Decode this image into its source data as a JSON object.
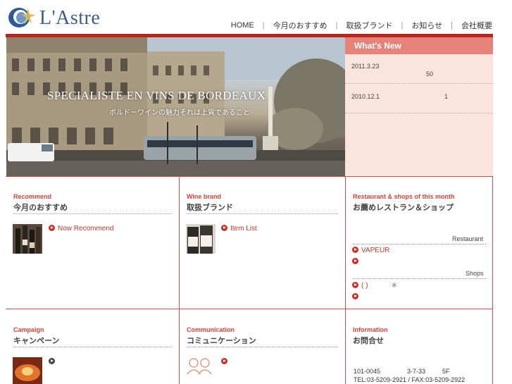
{
  "header": {
    "logo_text": "L'Astre",
    "nav": [
      {
        "label": "HOME"
      },
      {
        "label": "今月のおすすめ"
      },
      {
        "label": "取扱ブランド"
      },
      {
        "label": "お知らせ"
      },
      {
        "label": "会社概要"
      }
    ]
  },
  "hero": {
    "title": "SPECIALISTE EN VINS DE BORDEAUX",
    "subtitle": "ボルドーワインの魅力それは上質であること"
  },
  "news": {
    "heading": "What's New",
    "items": [
      {
        "date": "2011.3.23",
        "value": "50"
      },
      {
        "date": "2010.12.1",
        "value": "1"
      }
    ]
  },
  "sections": {
    "recommend": {
      "tag": "Recommend",
      "title": "今月のおすすめ",
      "link": "Now Recommend"
    },
    "wine_brand": {
      "tag": "Wine brand",
      "title": "取扱ブランド",
      "link": "Item List"
    },
    "restaurant": {
      "tag": "Restaurant & shops of this month",
      "title": "お薦めレストラン＆ショップ",
      "restaurant_label": "Restaurant",
      "restaurant_link": "VAPEUR",
      "shops_label": "Shops",
      "shops_link": "( )",
      "shops_mark": "※"
    },
    "campaign": {
      "tag": "Campaign",
      "title": "キャンペーン"
    },
    "communication": {
      "tag": "Communication",
      "title": "コミュニケーション"
    },
    "information": {
      "tag": "Information",
      "title": "お問合せ",
      "postal": "101-0045",
      "address_no": "3-7-33",
      "floor": "5F",
      "tel_fax": "TEL:03-5209-2921 / FAX:03-5209-2922"
    }
  },
  "colors": {
    "brand_red": "#b7281c",
    "accent_red": "#c9302a",
    "news_header": "#e5837a",
    "news_bg": "#fbe3de",
    "logo_blue": "#3a5d8e"
  }
}
